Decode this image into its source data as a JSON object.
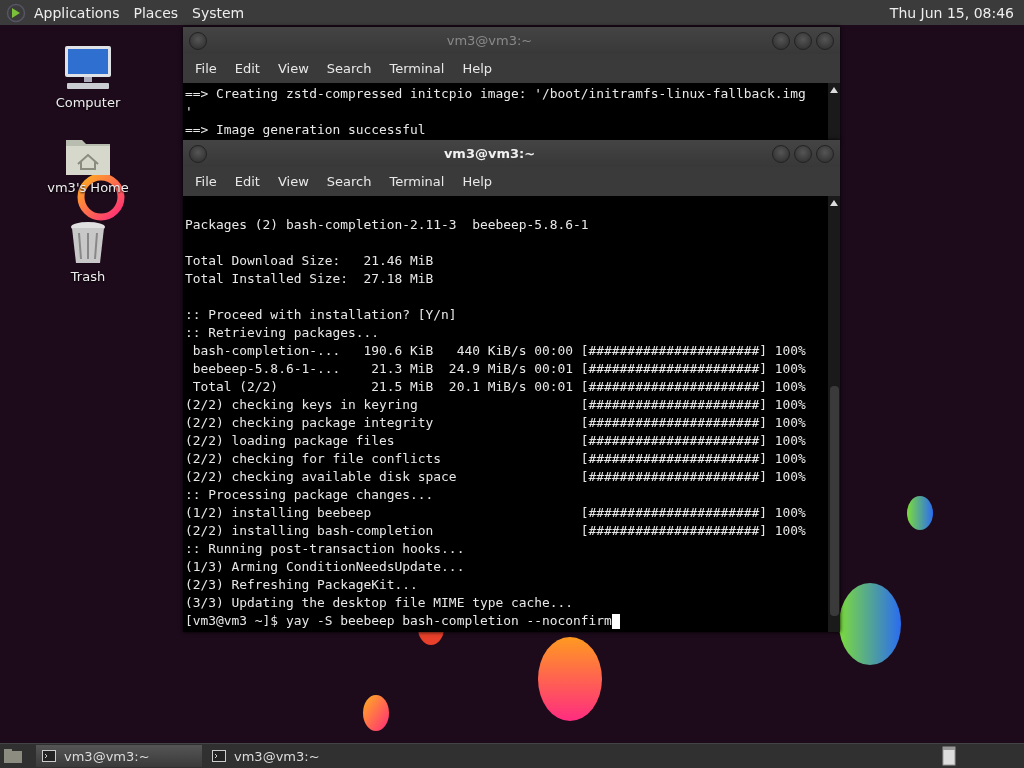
{
  "top_panel": {
    "menus": [
      "Applications",
      "Places",
      "System"
    ],
    "clock": "Thu Jun 15, 08:46"
  },
  "desktop_icons": [
    {
      "kind": "computer",
      "label": "Computer"
    },
    {
      "kind": "home",
      "label": "vm3's Home"
    },
    {
      "kind": "trash",
      "label": "Trash"
    }
  ],
  "windows": [
    {
      "title": "vm3@vm3:~",
      "active": false,
      "menu": [
        "File",
        "Edit",
        "View",
        "Search",
        "Terminal",
        "Help"
      ],
      "lines": [
        "==> Creating zstd-compressed initcpio image: '/boot/initramfs-linux-fallback.img",
        "'",
        "==> Image generation successful"
      ],
      "cursor": false
    },
    {
      "title": "vm3@vm3:~",
      "active": true,
      "menu": [
        "File",
        "Edit",
        "View",
        "Search",
        "Terminal",
        "Help"
      ],
      "lines": [
        {
          "kind": "blank"
        },
        "Packages (2) bash-completion-2.11-3  beebeep-5.8.6-1",
        {
          "kind": "blank"
        },
        "Total Download Size:   21.46 MiB",
        "Total Installed Size:  27.18 MiB",
        {
          "kind": "blank"
        },
        ":: Proceed with installation? [Y/n]",
        ":: Retrieving packages...",
        " bash-completion-...   190.6 KiB   440 KiB/s 00:00 [######################] 100%",
        " beebeep-5.8.6-1-...    21.3 MiB  24.9 MiB/s 00:01 [######################] 100%",
        " Total (2/2)            21.5 MiB  20.1 MiB/s 00:01 [######################] 100%",
        "(2/2) checking keys in keyring                     [######################] 100%",
        "(2/2) checking package integrity                   [######################] 100%",
        "(2/2) loading package files                        [######################] 100%",
        "(2/2) checking for file conflicts                  [######################] 100%",
        "(2/2) checking available disk space                [######################] 100%",
        ":: Processing package changes...",
        "(1/2) installing beebeep                           [######################] 100%",
        "(2/2) installing bash-completion                   [######################] 100%",
        ":: Running post-transaction hooks...",
        "(1/3) Arming ConditionNeedsUpdate...",
        "(2/3) Refreshing PackageKit...",
        "(3/3) Updating the desktop file MIME type cache...",
        "[vm3@vm3 ~]$ yay -S beebeep bash-completion --noconfirm"
      ],
      "cursor": true
    }
  ],
  "taskbar": {
    "tasks": [
      {
        "label": "vm3@vm3:~",
        "selected": true
      },
      {
        "label": "vm3@vm3:~",
        "selected": false
      }
    ]
  }
}
